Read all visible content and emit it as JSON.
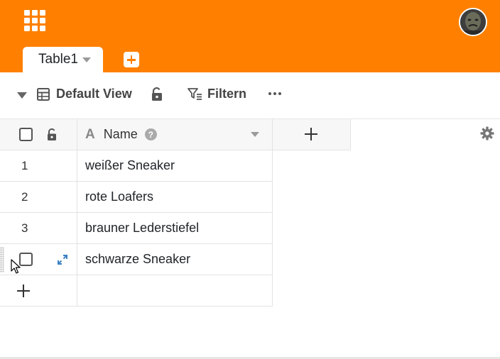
{
  "header": {
    "background_color": "#ff8000",
    "apps_icon": "grid-apps-icon",
    "avatar_icon": "user-avatar"
  },
  "tabs": [
    {
      "label": "Table1",
      "icon": "chevron-down-icon"
    }
  ],
  "add_table_icon": "plus-square-icon",
  "toolbar": {
    "view_toggle_icon": "caret-down-icon",
    "view_icon": "table-icon",
    "view_label": "Default View",
    "lock_icon": "unlock-icon",
    "filter_icon": "filter-icon",
    "filter_label": "Filtern",
    "more_icon": "more-horizontal-icon"
  },
  "table": {
    "columns": [
      {
        "name": "Name",
        "type_icon": "text-type-icon",
        "help_label": "?"
      }
    ],
    "add_column_icon": "plus-icon",
    "settings_icon": "gear-icon",
    "rows": [
      {
        "index": "1",
        "name": "weißer Sneaker"
      },
      {
        "index": "2",
        "name": "rote Loafers"
      },
      {
        "index": "3",
        "name": "brauner Lederstiefel"
      },
      {
        "index": "",
        "name": "schwarze Sneaker",
        "hovered": true
      }
    ],
    "add_row_icon": "plus-icon"
  }
}
